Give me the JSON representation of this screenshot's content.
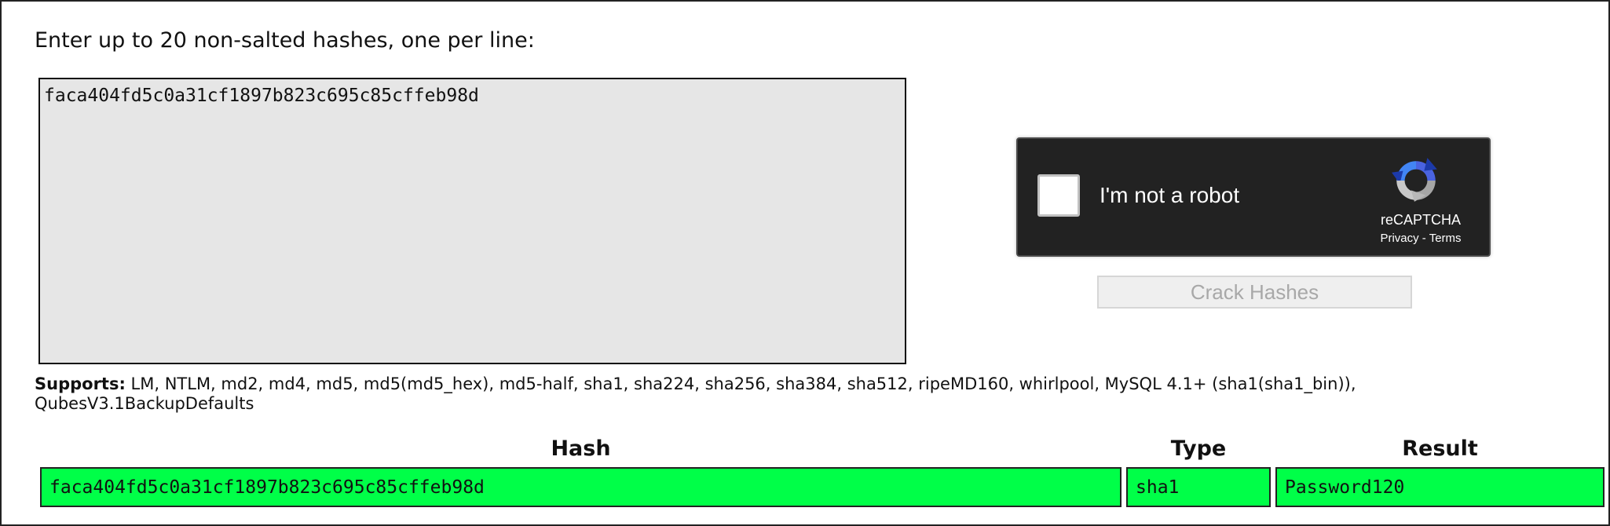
{
  "instructions": "Enter up to 20 non-salted hashes, one per line:",
  "hash_input": {
    "value": "faca404fd5c0a31cf1897b823c695c85cffeb98d"
  },
  "recaptcha": {
    "label": "I'm not a robot",
    "brand": "reCAPTCHA",
    "privacy": "Privacy",
    "separator": " - ",
    "terms": "Terms",
    "logo_icon": "recaptcha-logo-icon"
  },
  "crack_button": {
    "label": "Crack Hashes"
  },
  "supports": {
    "label": "Supports:",
    "text": " LM, NTLM, md2, md4, md5, md5(md5_hex), md5-half, sha1, sha224, sha256, sha384, sha512, ripeMD160, whirlpool, MySQL 4.1+ (sha1(sha1_bin)), QubesV3.1BackupDefaults"
  },
  "results": {
    "headers": {
      "hash": "Hash",
      "type": "Type",
      "result": "Result"
    },
    "rows": [
      {
        "hash": "faca404fd5c0a31cf1897b823c695c85cffeb98d",
        "type": "sha1",
        "result": "Password120"
      }
    ]
  },
  "colors": {
    "success": "#00ff48",
    "input_bg": "#e6e6e6",
    "recaptcha_bg": "#222222"
  }
}
